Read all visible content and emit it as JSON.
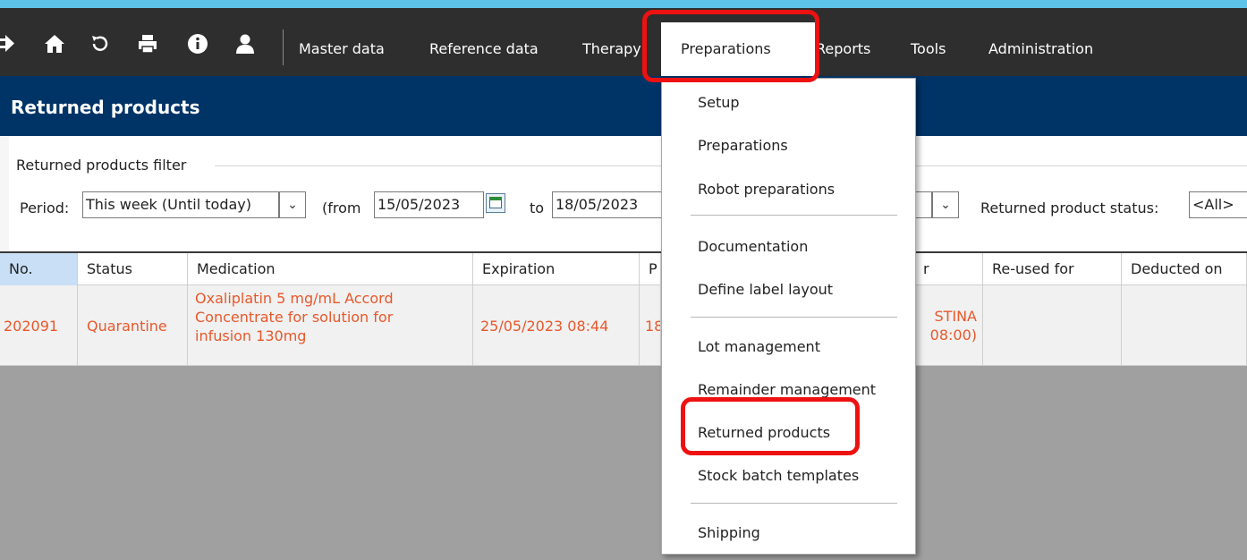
{
  "menubar": {
    "icons": [
      "exit-icon",
      "home-icon",
      "refresh-icon",
      "print-icon",
      "info-icon",
      "user-icon"
    ],
    "items": [
      "Master data",
      "Reference data",
      "Therapy",
      "Preparations",
      "Reports",
      "Tools",
      "Administration"
    ],
    "active": "Preparations"
  },
  "page": {
    "title": "Returned products"
  },
  "filter": {
    "legend": "Returned products filter",
    "period_label": "Period:",
    "period_value": "This week (Until today)",
    "from_label": "(from",
    "from_value": "15/05/2023",
    "to_label": "to",
    "to_value": "18/05/2023",
    "status_label": "Returned product status:",
    "status_value": "<All>"
  },
  "table": {
    "columns": [
      "No.",
      "Status",
      "Medication",
      "Expiration",
      "P",
      "r",
      "Re-used for",
      "Deducted on"
    ],
    "rows": [
      {
        "no": "202091",
        "status": "Quarantine",
        "medication": "Oxaliplatin 5 mg/mL Accord Concentrate for solution for infusion 130mg",
        "expiration": "25/05/2023 08:44",
        "p": "18",
        "other": "STINA 08:00)",
        "reused_for": "",
        "deducted_on": ""
      }
    ]
  },
  "dropdown": {
    "items": [
      "Setup",
      "Preparations",
      "Robot preparations",
      "Documentation",
      "Define label layout",
      "Lot management",
      "Remainder management",
      "Returned products",
      "Stock batch templates",
      "Shipping"
    ]
  },
  "colors": {
    "menubar": "#2e2e2e",
    "title_bar": "#003366",
    "accent_strip": "#5ec3e8",
    "row_text": "#e8582a",
    "highlight": "#ee1111",
    "grid_empty": "#a0a0a0"
  }
}
